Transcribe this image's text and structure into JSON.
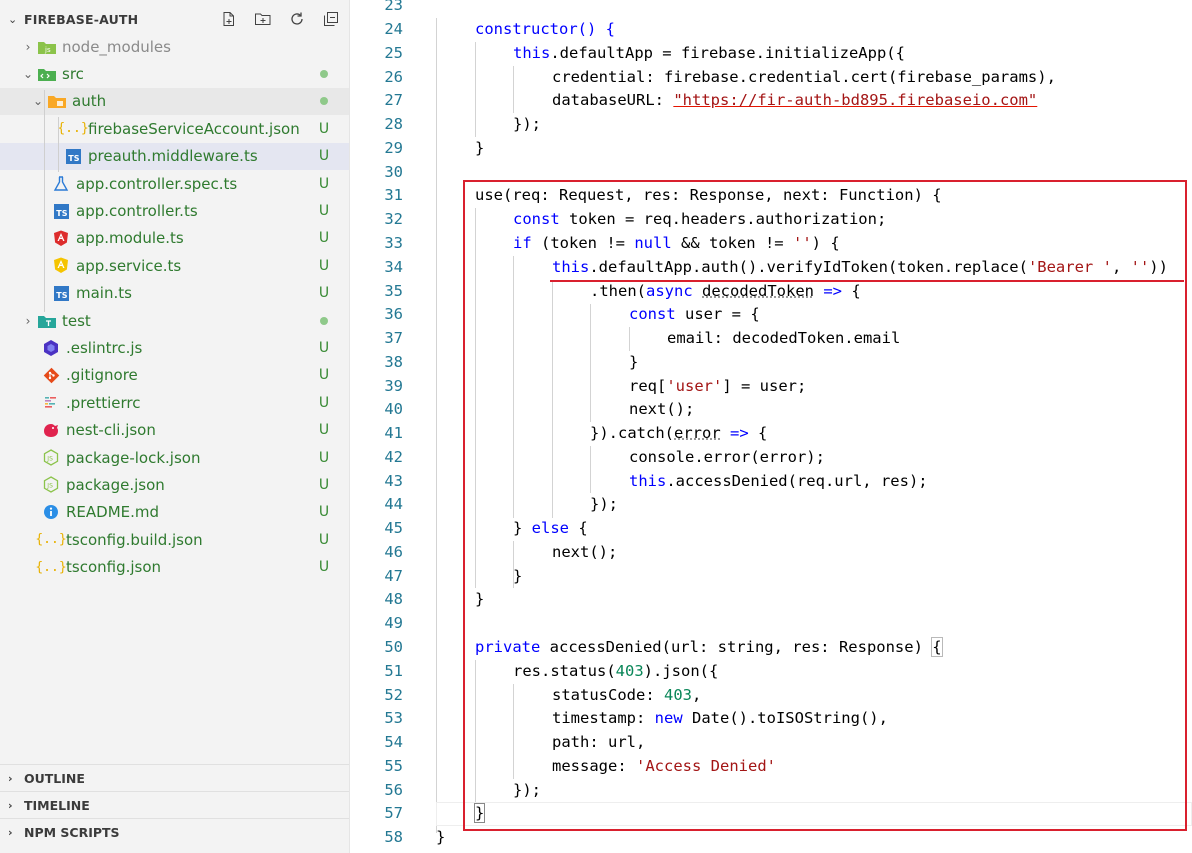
{
  "explorer": {
    "title": "FIREBASE-AUTH",
    "action_icons": [
      "new-file-icon",
      "new-folder-icon",
      "refresh-icon",
      "collapse-all-icon"
    ],
    "items": [
      {
        "label": "node_modules",
        "badge": ""
      },
      {
        "label": "src",
        "badge": "dot"
      },
      {
        "label": "auth",
        "badge": "dot"
      },
      {
        "label": "firebaseServiceAccount.json",
        "badge": "U"
      },
      {
        "label": "preauth.middleware.ts",
        "badge": "U"
      },
      {
        "label": "app.controller.spec.ts",
        "badge": "U"
      },
      {
        "label": "app.controller.ts",
        "badge": "U"
      },
      {
        "label": "app.module.ts",
        "badge": "U"
      },
      {
        "label": "app.service.ts",
        "badge": "U"
      },
      {
        "label": "main.ts",
        "badge": "U"
      },
      {
        "label": "test",
        "badge": "dot"
      },
      {
        "label": ".eslintrc.js",
        "badge": "U"
      },
      {
        "label": ".gitignore",
        "badge": "U"
      },
      {
        "label": ".prettierrc",
        "badge": "U"
      },
      {
        "label": "nest-cli.json",
        "badge": "U"
      },
      {
        "label": "package-lock.json",
        "badge": "U"
      },
      {
        "label": "package.json",
        "badge": "U"
      },
      {
        "label": "README.md",
        "badge": "U"
      },
      {
        "label": "tsconfig.build.json",
        "badge": "U"
      },
      {
        "label": "tsconfig.json",
        "badge": "U"
      }
    ],
    "file_icon_names": {
      "json": "json-braces-icon",
      "ts": "typescript-icon",
      "spec": "flask-test-icon",
      "module": "angular-icon",
      "service": "service-icon",
      "eslint": "eslint-icon",
      "git": "git-icon",
      "prettier": "prettier-icon",
      "nest": "nestjs-icon",
      "node": "nodejs-icon",
      "readme": "info-icon"
    }
  },
  "panels": [
    "OUTLINE",
    "TIMELINE",
    "NPM SCRIPTS"
  ],
  "editor": {
    "first_line_number": 23,
    "partial_top_line": "23",
    "lines": [
      {
        "n": "24"
      },
      {
        "n": "25"
      },
      {
        "n": "26"
      },
      {
        "n": "27"
      },
      {
        "n": "28"
      },
      {
        "n": "29"
      },
      {
        "n": "30"
      },
      {
        "n": "31"
      },
      {
        "n": "32"
      },
      {
        "n": "33"
      },
      {
        "n": "34"
      },
      {
        "n": "35"
      },
      {
        "n": "36"
      },
      {
        "n": "37"
      },
      {
        "n": "38"
      },
      {
        "n": "39"
      },
      {
        "n": "40"
      },
      {
        "n": "41"
      },
      {
        "n": "42"
      },
      {
        "n": "43"
      },
      {
        "n": "44"
      },
      {
        "n": "45"
      },
      {
        "n": "46"
      },
      {
        "n": "47"
      },
      {
        "n": "48"
      },
      {
        "n": "49"
      },
      {
        "n": "50"
      },
      {
        "n": "51"
      },
      {
        "n": "52"
      },
      {
        "n": "53"
      },
      {
        "n": "54"
      },
      {
        "n": "55"
      },
      {
        "n": "56"
      },
      {
        "n": "57"
      },
      {
        "n": "58"
      }
    ],
    "code": {
      "l24_kw": "constructor() {",
      "l25_this": "this",
      "l25_rest": ".defaultApp = firebase.initializeApp({",
      "l26": "credential: firebase.credential.cert(firebase_params),",
      "l27_key": "databaseURL: ",
      "l27_url": "\"https://fir-auth-bd895.firebaseio.com\"",
      "l28": "});",
      "l29": "}",
      "l31": "use(req: Request, res: Response, next: Function) {",
      "l32_kw": "const",
      "l32_rest": " token = req.headers.authorization;",
      "l33_if": "if",
      "l33_a": " (token != ",
      "l33_null": "null",
      "l33_b": " && token != ",
      "l33_str": "''",
      "l33_c": ") {",
      "l34_this": "this",
      "l34_a": ".defaultApp.auth().verifyIdToken(token.replace(",
      "l34_s1": "'Bearer '",
      "l34_b": ", ",
      "l34_s2": "''",
      "l34_c": "))",
      "l35_a": ".then(",
      "l35_async": "async",
      "l35_sp": " ",
      "l35_dec": "decodedToken",
      "l35_arrow": " =>",
      "l35_b": " {",
      "l36_kw": "const",
      "l36_rest": " user = {",
      "l37": "email: decodedToken.email",
      "l38": "}",
      "l39_a": "req[",
      "l39_s": "'user'",
      "l39_b": "] = user;",
      "l40": "next();",
      "l41_a": "}).catch(",
      "l41_err": "error",
      "l41_arrow": " =>",
      "l41_b": " {",
      "l42": "console.error(error);",
      "l43_this": "this",
      "l43_rest": ".accessDenied(req.url, res);",
      "l44": "});",
      "l45_a": "} ",
      "l45_else": "else",
      "l45_b": " {",
      "l46": "next();",
      "l47": "}",
      "l48": "}",
      "l50_kw": "private",
      "l50_rest": " accessDenied(url: string, res: Response) ",
      "l50_brace": "{",
      "l51_a": "res.status(",
      "l51_num": "403",
      "l51_b": ").json({",
      "l52_key": "statusCode: ",
      "l52_num": "403",
      "l52_c": ",",
      "l53_key": "timestamp: ",
      "l53_new": "new",
      "l53_rest": " Date().toISOString(),",
      "l54": "path: url,",
      "l55_key": "message: ",
      "l55_str": "'Access Denied'",
      "l56": "});",
      "l57": "}",
      "l58": "}"
    },
    "colors": {
      "keyword": "#0000ff",
      "string": "#a31515",
      "number": "#098658",
      "line_number": "#237893",
      "highlight_box": "#d9202e"
    }
  }
}
